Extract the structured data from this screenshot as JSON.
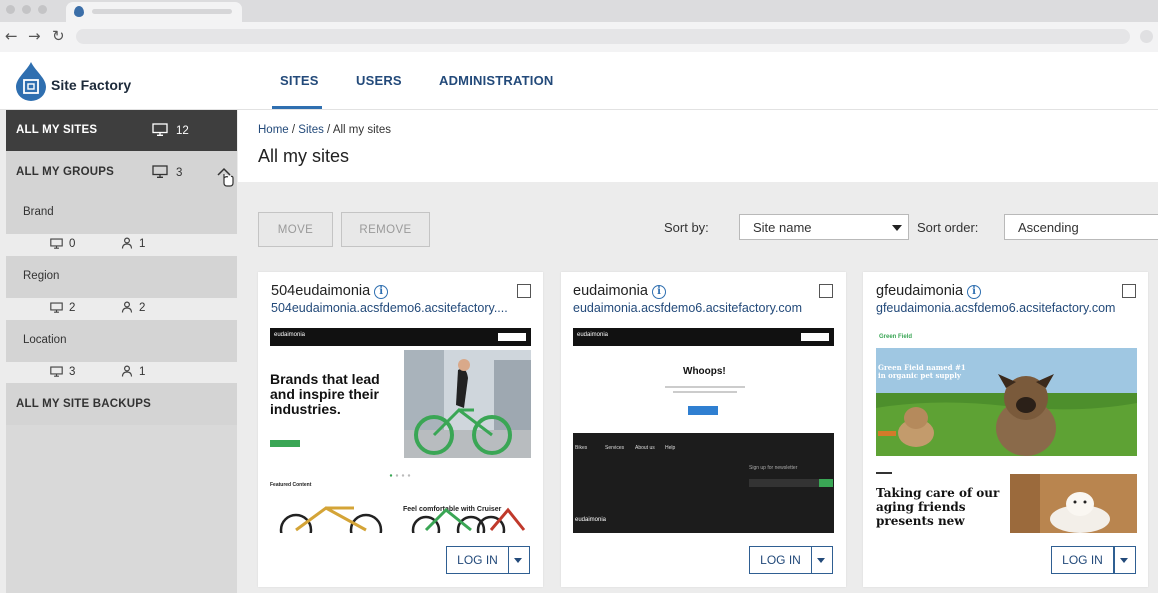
{
  "app": {
    "name": "Site Factory"
  },
  "topnav": [
    {
      "label": "SITES",
      "active": true
    },
    {
      "label": "USERS",
      "active": false
    },
    {
      "label": "ADMINISTRATION",
      "active": false
    }
  ],
  "sidebar": {
    "all_sites": {
      "label": "ALL MY SITES",
      "count": "12"
    },
    "all_groups": {
      "label": "ALL MY GROUPS",
      "count": "3"
    },
    "groups": [
      {
        "label": "Brand",
        "sites": "0",
        "users": "1"
      },
      {
        "label": "Region",
        "sites": "2",
        "users": "2"
      },
      {
        "label": "Location",
        "sites": "3",
        "users": "1"
      }
    ],
    "backups": {
      "label": "ALL MY SITE BACKUPS"
    }
  },
  "breadcrumb": {
    "home": "Home",
    "sites": "Sites",
    "current": "All my sites"
  },
  "page_title": "All my sites",
  "toolbar": {
    "move_label": "MOVE",
    "remove_label": "REMOVE",
    "sort_by_label": "Sort by:",
    "sort_by_value": "Site name",
    "sort_order_label": "Sort order:",
    "sort_order_value": "Ascending"
  },
  "cards": [
    {
      "name": "504eudaimonia",
      "url": "504eudaimonia.acsfdemo6.acsitefactory....",
      "login_label": "LOG IN",
      "thumb": {
        "brand": "eudaimonia",
        "headline_1": "Brands that lead",
        "headline_2": "and inspire their",
        "headline_3": "industries.",
        "section": "Featured Content",
        "caption": "Feel comfortable with Cruiser"
      }
    },
    {
      "name": "eudaimonia",
      "url": "eudaimonia.acsfdemo6.acsitefactory.com",
      "login_label": "LOG IN",
      "thumb": {
        "brand": "eudaimonia",
        "headline_1": "Whoops!",
        "footer_col_1": "Bikes",
        "footer_col_2": "Services",
        "footer_col_3": "About us",
        "footer_col_4": "Help",
        "newsletter": "Sign up for newsletter"
      }
    },
    {
      "name": "gfeudaimonia",
      "url": "gfeudaimonia.acsfdemo6.acsitefactory.com",
      "login_label": "LOG IN",
      "thumb": {
        "brand": "Green Field",
        "hero": "Green Field named #1 in organic pet supply",
        "headline_1": "Taking care of our",
        "headline_2": "aging friends",
        "headline_3": "presents new"
      }
    }
  ],
  "colors": {
    "primary": "#234a7a",
    "accent": "#2f6fb0",
    "sidebar_dark": "#3e3e3e",
    "sidebar_bg": "#d9d9d9",
    "thumb_green": "#3aa655"
  }
}
